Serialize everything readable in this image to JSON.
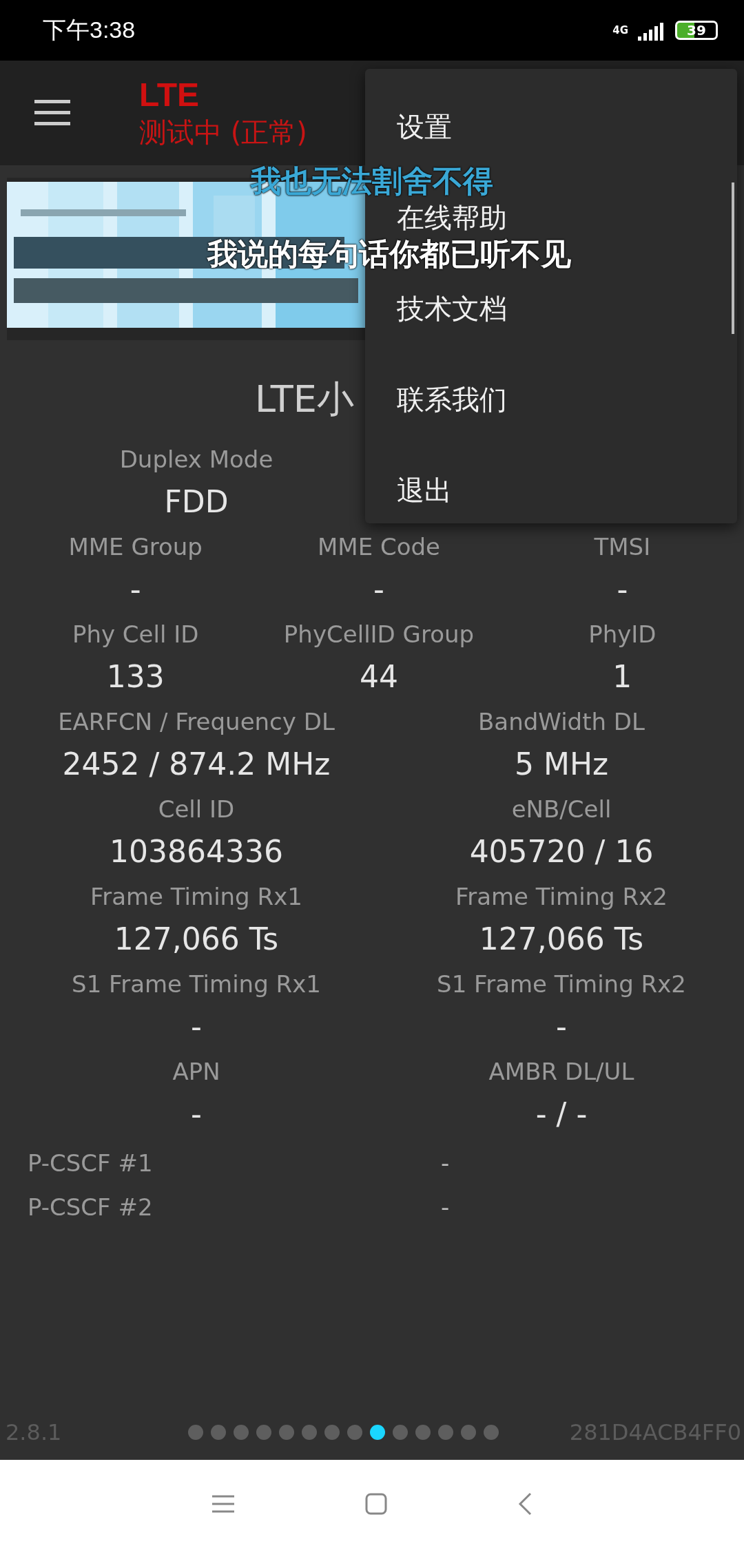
{
  "status_bar": {
    "time": "下午3:38",
    "network": "4G",
    "battery": "39"
  },
  "toolbar": {
    "title": "LTE",
    "subtitle": "测试中 (正常)"
  },
  "section_title": "LTE小",
  "rows": [
    {
      "kind": "pair",
      "cells": [
        {
          "label": "Duplex Mode",
          "value": "FDD"
        }
      ]
    },
    {
      "kind": "triple",
      "cells": [
        {
          "label": "MME Group",
          "value": "-"
        },
        {
          "label": "MME Code",
          "value": "-"
        },
        {
          "label": "TMSI",
          "value": "-"
        }
      ]
    },
    {
      "kind": "triple",
      "cells": [
        {
          "label": "Phy Cell ID",
          "value": "133"
        },
        {
          "label": "PhyCellID Group",
          "value": "44"
        },
        {
          "label": "PhyID",
          "value": "1"
        }
      ]
    },
    {
      "kind": "pair",
      "cells": [
        {
          "label": "EARFCN / Frequency DL",
          "value": "2452 / 874.2 MHz"
        },
        {
          "label": "BandWidth DL",
          "value": "5 MHz"
        }
      ]
    },
    {
      "kind": "pair",
      "cells": [
        {
          "label": "Cell ID",
          "value": "103864336"
        },
        {
          "label": "eNB/Cell",
          "value": "405720 / 16"
        }
      ]
    },
    {
      "kind": "pair",
      "cells": [
        {
          "label": "Frame Timing Rx1",
          "value": "127,066 Ts"
        },
        {
          "label": "Frame Timing Rx2",
          "value": "127,066 Ts"
        }
      ]
    },
    {
      "kind": "pair",
      "cells": [
        {
          "label": "S1 Frame Timing Rx1",
          "value": "-"
        },
        {
          "label": "S1 Frame Timing Rx2",
          "value": "-"
        }
      ]
    },
    {
      "kind": "pair",
      "cells": [
        {
          "label": "APN",
          "value": "-"
        },
        {
          "label": "AMBR DL/UL",
          "value": "- / -"
        }
      ]
    },
    {
      "kind": "inline",
      "cells": [
        {
          "label": "P-CSCF #1",
          "value": "-"
        }
      ]
    },
    {
      "kind": "inline",
      "cells": [
        {
          "label": "P-CSCF #2",
          "value": "-"
        }
      ]
    }
  ],
  "footer": {
    "version": "2.8.1",
    "device_id": "281D4ACB4FF0",
    "pages": [
      {
        "selected": false
      },
      {
        "selected": false
      },
      {
        "selected": false
      },
      {
        "selected": false
      },
      {
        "selected": false
      },
      {
        "selected": false
      },
      {
        "selected": false
      },
      {
        "selected": false
      },
      {
        "selected": true
      },
      {
        "selected": false
      },
      {
        "selected": false
      },
      {
        "selected": false
      },
      {
        "selected": false
      },
      {
        "selected": false
      }
    ]
  },
  "menu": {
    "items": [
      "设置",
      "在线帮助",
      "技术文档",
      "联系我们",
      "退出"
    ]
  },
  "lyrics_overlay": {
    "lines": [
      "我也无法割舍不得",
      "我说的每句话你都已听不见"
    ]
  }
}
